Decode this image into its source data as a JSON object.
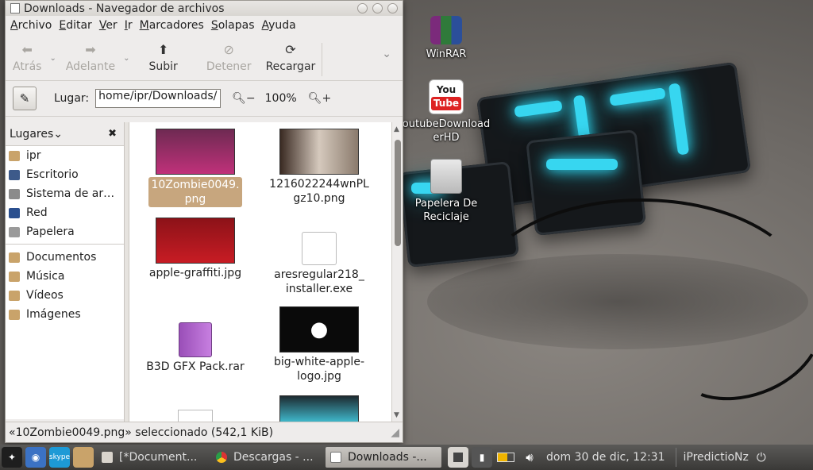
{
  "window": {
    "title": "Downloads - Navegador de archivos",
    "menu": [
      "Archivo",
      "Editar",
      "Ver",
      "Ir",
      "Marcadores",
      "Solapas",
      "Ayuda"
    ],
    "toolbar": {
      "back": "Atrás",
      "forward": "Adelante",
      "up": "Subir",
      "stop": "Detener",
      "reload": "Recargar"
    },
    "location": {
      "label": "Lugar:",
      "path": "/home/ipr/Downloads",
      "zoom": "100%"
    },
    "sidebar": {
      "header": "Lugares",
      "places": [
        {
          "label": "ipr",
          "icon": "home-folder-icon",
          "color": "#c9a36a"
        },
        {
          "label": "Escritorio",
          "icon": "desktop-icon",
          "color": "#3d5a8a"
        },
        {
          "label": "Sistema de ar…",
          "icon": "drive-icon",
          "color": "#8b8b8b"
        },
        {
          "label": "Red",
          "icon": "network-icon",
          "color": "#2a4f8f"
        },
        {
          "label": "Papelera",
          "icon": "trash-icon",
          "color": "#9a9a9a"
        }
      ],
      "bookmarks": [
        {
          "label": "Documentos",
          "icon": "folder-icon",
          "color": "#c9a36a"
        },
        {
          "label": "Música",
          "icon": "folder-icon",
          "color": "#c9a36a"
        },
        {
          "label": "Vídeos",
          "icon": "folder-icon",
          "color": "#c9a36a"
        },
        {
          "label": "Imágenes",
          "icon": "folder-icon",
          "color": "#c9a36a"
        }
      ]
    },
    "files": [
      {
        "name": "10Zombie0049.\npng",
        "selected": true
      },
      {
        "name": "1216022244wnPL\ngz10.png",
        "selected": false
      },
      {
        "name": "apple-graffiti.jpg",
        "selected": false
      },
      {
        "name": "aresregular218_\ninstaller.exe",
        "selected": false
      },
      {
        "name": "B3D GFX Pack.rar",
        "selected": false
      },
      {
        "name": "big-white-apple-\nlogo.jpg",
        "selected": false
      }
    ],
    "status": "«10Zombie0049.png» seleccionado (542,1 KiB)"
  },
  "desktop": {
    "icons": [
      {
        "label": "WinRAR"
      },
      {
        "label": "outubeDownload\nerHD"
      },
      {
        "label": "Papelera De\nReciclaje"
      }
    ]
  },
  "taskbar": {
    "tasks": [
      {
        "label": "[*Document...",
        "icon": "document-icon"
      },
      {
        "label": "Descargas - ...",
        "icon": "chrome-icon"
      },
      {
        "label": "Downloads -...",
        "icon": "file-manager-icon"
      }
    ],
    "clock": "dom 30 de dic, 12:31",
    "user": "iPredictioNz",
    "launcher": {
      "skype": "skype"
    }
  },
  "colors": {
    "accent_selected": "#c7a67e",
    "glow": "#37d6f0"
  }
}
